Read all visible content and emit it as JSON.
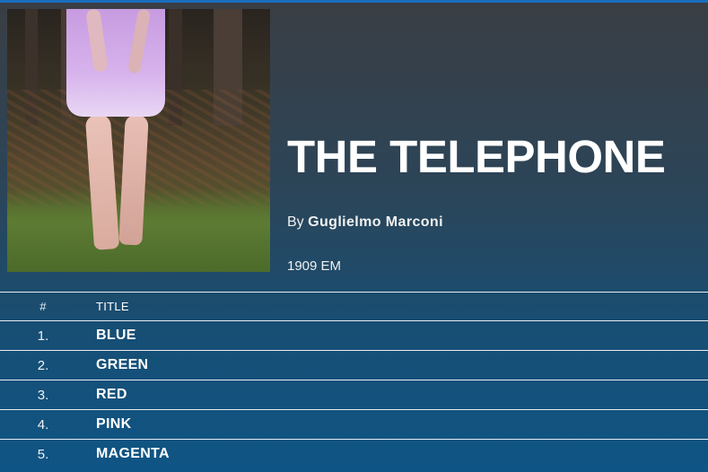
{
  "album": {
    "title": "THE TELEPHONE",
    "by_prefix": "By",
    "artist": "Guglielmo Marconi",
    "year": "1909 EM"
  },
  "tracklist": {
    "headers": {
      "number": "#",
      "title": "TITLE"
    },
    "tracks": [
      {
        "number": "1.",
        "title": "BLUE"
      },
      {
        "number": "2.",
        "title": "GREEN"
      },
      {
        "number": "3.",
        "title": "RED"
      },
      {
        "number": "4.",
        "title": "PINK"
      },
      {
        "number": "5.",
        "title": "MAGENTA"
      }
    ]
  },
  "colors": {
    "accent_strip": "#1a6ebd",
    "row_divider": "#e8eef3",
    "text": "#ffffff"
  }
}
